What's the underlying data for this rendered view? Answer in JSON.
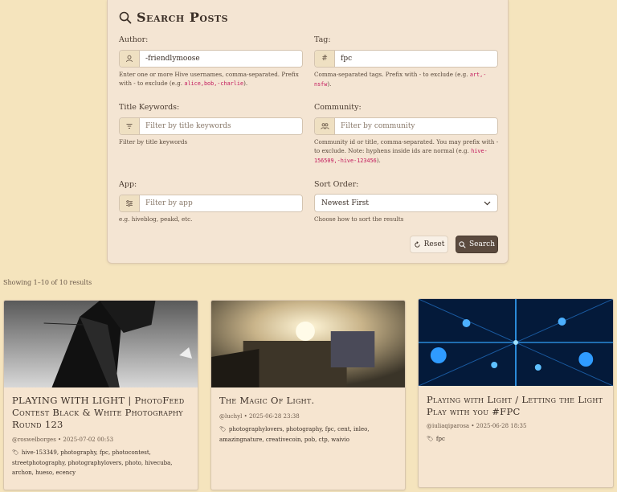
{
  "search": {
    "title": "Search Posts",
    "author": {
      "label": "Author:",
      "value": "-friendlymoose",
      "help_pre": "Enter one or more Hive usernames, comma-separated. Prefix with - to exclude (e.g. ",
      "help_code": "alice,bob,-charlie",
      "help_post": ")."
    },
    "tag": {
      "label": "Tag:",
      "value": "fpc",
      "help_pre": "Comma-separated tags. Prefix with - to exclude (e.g. ",
      "help_code": "art,-nsfw",
      "help_post": ")."
    },
    "title_keywords": {
      "label": "Title Keywords:",
      "placeholder": "Filter by title keywords",
      "help": "Filter by title keywords"
    },
    "community": {
      "label": "Community:",
      "placeholder": "Filter by community",
      "help_pre": "Community id or title, comma-separated. You may prefix with - to exclude. Note: hyphens inside ids are normal (e.g. ",
      "help_code": "hive-156509,-hive-123456",
      "help_post": ")."
    },
    "app": {
      "label": "App:",
      "placeholder": "Filter by app",
      "help": "e.g. hiveblog, peakd, etc."
    },
    "sort": {
      "label": "Sort Order:",
      "selected": "Newest First",
      "help": "Choose how to sort the results"
    },
    "reset_label": "Reset",
    "search_label": "Search"
  },
  "results": {
    "showing": "Showing 1–10 of 10 results",
    "cards": [
      {
        "title": "PLAYING WITH LIGHT | PhotoFeed Contest Black & White Photography Round 123",
        "meta": "@roswelborges • 2025-07-02 00:53",
        "tags": "hive-153349, photography, fpc, photocontest, streetphotography, photographylovers, photo, hivecuba, archon, hueso, ecency"
      },
      {
        "title": "The Magic Of Light.",
        "meta": "@luchyl • 2025-06-28 23:38",
        "tags": "photographylovers, photography, fpc, cent, inleo, amazingnature, creativecoin, pob, ctp, waivio"
      },
      {
        "title": "Playing with Light / Letting the Light Play with you #FPC",
        "meta": "@iuliaqiparosa • 2025-06-28 18:35",
        "tags": "fpc"
      }
    ]
  }
}
